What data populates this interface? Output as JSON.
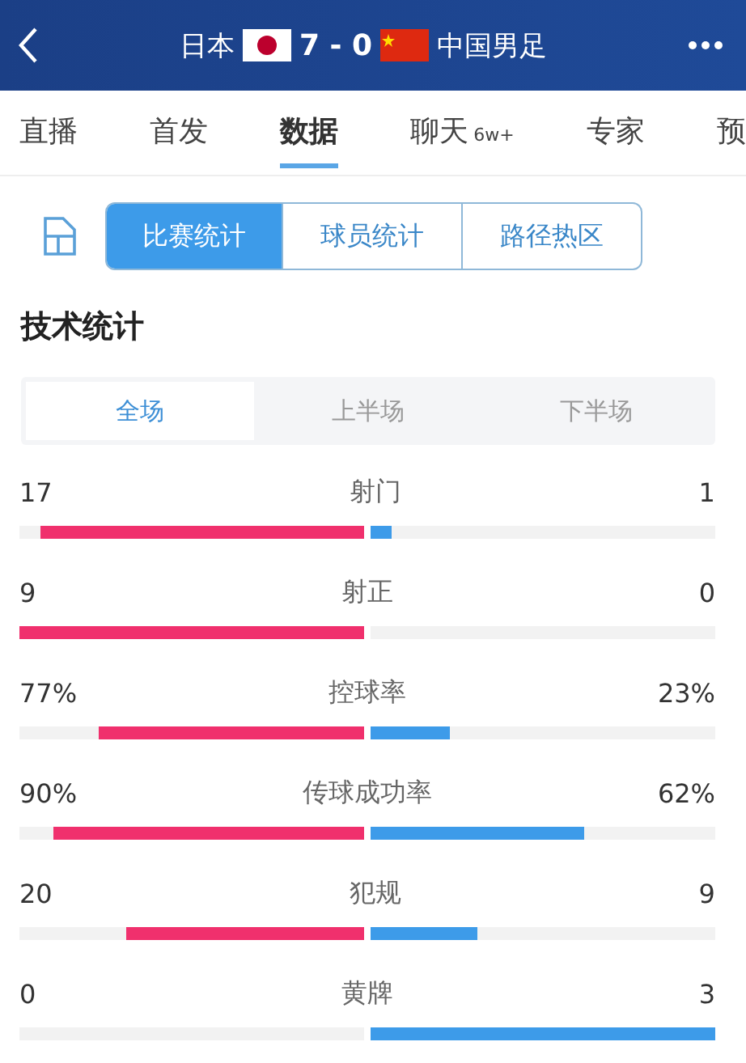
{
  "header": {
    "home": "日本",
    "score": "7 - 0",
    "away": "中国男足"
  },
  "tabs": [
    {
      "label": "直播",
      "selected": false
    },
    {
      "label": "首发",
      "selected": false
    },
    {
      "label": "数据",
      "selected": true
    },
    {
      "label": "聊天",
      "badge": "6w+",
      "selected": false
    },
    {
      "label": "专家",
      "selected": false
    },
    {
      "label": "预",
      "selected": false
    }
  ],
  "segments": [
    {
      "label": "比赛统计",
      "selected": true
    },
    {
      "label": "球员统计",
      "selected": false
    },
    {
      "label": "路径热区",
      "selected": false
    }
  ],
  "section_title": "技术统计",
  "periods": [
    {
      "label": "全场",
      "selected": true
    },
    {
      "label": "上半场",
      "selected": false
    },
    {
      "label": "下半场",
      "selected": false
    }
  ],
  "stats": [
    {
      "name": "射门",
      "home": {
        "value": "17",
        "level": 0.94
      },
      "away": {
        "value": "1",
        "level": 0.06
      }
    },
    {
      "name": "射正",
      "home": {
        "value": "9",
        "level": 1
      },
      "away": {
        "value": "0",
        "level": 0
      }
    },
    {
      "name": "控球率",
      "home": {
        "value": "77%",
        "level": 0.77
      },
      "away": {
        "value": "23%",
        "level": 0.23
      }
    },
    {
      "name": "传球成功率",
      "home": {
        "value": "90%",
        "level": 0.9
      },
      "away": {
        "value": "62%",
        "level": 0.62
      }
    },
    {
      "name": "犯规",
      "home": {
        "value": "20",
        "level": 0.69
      },
      "away": {
        "value": "9",
        "level": 0.31
      }
    },
    {
      "name": "黄牌",
      "home": {
        "value": "0",
        "level": 0
      },
      "away": {
        "value": "3",
        "level": 1
      }
    }
  ]
}
